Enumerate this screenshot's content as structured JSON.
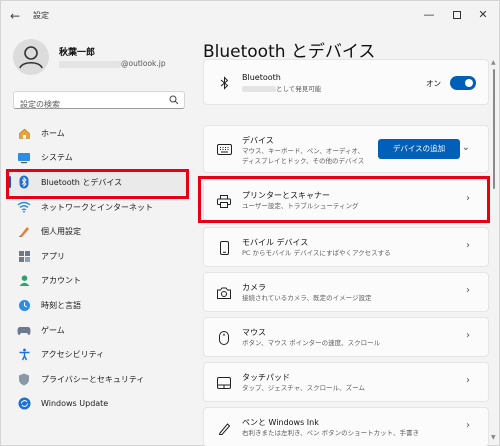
{
  "window": {
    "title": "設定",
    "controls": {
      "minimize": "—",
      "close": "✕"
    }
  },
  "user": {
    "name": "秋葉一郎",
    "email_domain": "@outlook.jp"
  },
  "search": {
    "placeholder": "設定の検索"
  },
  "sidebar": {
    "items": [
      {
        "label": "ホーム",
        "icon": "home-icon"
      },
      {
        "label": "システム",
        "icon": "system-icon"
      },
      {
        "label": "Bluetooth とデバイス",
        "icon": "bluetooth-icon",
        "active": true
      },
      {
        "label": "ネットワークとインターネット",
        "icon": "network-icon"
      },
      {
        "label": "個人用設定",
        "icon": "personalization-icon"
      },
      {
        "label": "アプリ",
        "icon": "apps-icon"
      },
      {
        "label": "アカウント",
        "icon": "account-icon"
      },
      {
        "label": "時刻と言語",
        "icon": "time-language-icon"
      },
      {
        "label": "ゲーム",
        "icon": "gaming-icon"
      },
      {
        "label": "アクセシビリティ",
        "icon": "accessibility-icon"
      },
      {
        "label": "プライバシーとセキュリティ",
        "icon": "privacy-icon"
      },
      {
        "label": "Windows Update",
        "icon": "windows-update-icon"
      }
    ]
  },
  "main": {
    "title": "Bluetooth とデバイス",
    "bluetooth": {
      "title": "Bluetooth",
      "subtitle": "として発見可能",
      "toggle_label": "オン",
      "toggle_on": true
    },
    "cards": [
      {
        "title": "デバイス",
        "subtitle": "マウス、キーボード、ペン、オーディオ、ディスプレイとドック、その他のデバイス",
        "action": "デバイスの追加"
      },
      {
        "title": "プリンターとスキャナー",
        "subtitle": "ユーザー設定、トラブルシューティング"
      },
      {
        "title": "モバイル デバイス",
        "subtitle": "PC からモバイル デバイスにすばやくアクセスする"
      },
      {
        "title": "カメラ",
        "subtitle": "接続されているカメラ、既定のイメージ設定"
      },
      {
        "title": "マウス",
        "subtitle": "ボタン、マウス ポインターの速度、スクロール"
      },
      {
        "title": "タッチパッド",
        "subtitle": "タップ、ジェスチャ、スクロール、ズーム"
      },
      {
        "title": "ペンと Windows Ink",
        "subtitle": "右利きまたは左利き、ペン ボタンのショートカット、手書き"
      }
    ]
  },
  "colors": {
    "accent": "#005fb8",
    "highlight_red": "#e60012"
  }
}
